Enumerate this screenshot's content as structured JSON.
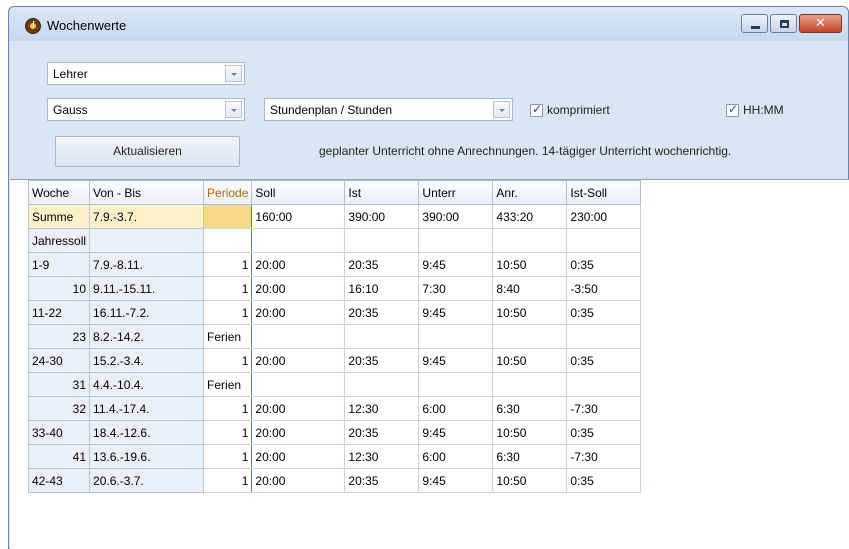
{
  "window": {
    "title": "Wochenwerte"
  },
  "filters": {
    "type_select": "Lehrer",
    "person_select": "Gauss",
    "view_select": "Stundenplan / Stunden",
    "komprimiert_label": "komprimiert",
    "komprimiert_checked": true,
    "hhmm_label": "HH:MM",
    "hhmm_checked": true,
    "refresh_label": "Aktualisieren",
    "hint": "geplanter Unterricht ohne Anrechnungen. 14-tägiger Unterricht wochenrichtig."
  },
  "table": {
    "columns": [
      "Woche",
      "Von - Bis",
      "Periode",
      "Soll",
      "Ist",
      "Unterr",
      "Anr.",
      "Ist-Soll"
    ],
    "rows": [
      [
        "Summe",
        "7.9.-3.7.",
        "",
        "160:00",
        "390:00",
        "390:00",
        "433:20",
        "230:00"
      ],
      [
        "Jahressoll",
        "",
        "",
        "",
        "",
        "",
        "",
        ""
      ],
      [
        "1-9",
        "7.9.-8.11.",
        "1",
        "20:00",
        "20:35",
        "9:45",
        "10:50",
        "0:35"
      ],
      [
        "10",
        "9.11.-15.11.",
        "1",
        "20:00",
        "16:10",
        "7:30",
        "8:40",
        "-3:50"
      ],
      [
        "11-22",
        "16.11.-7.2.",
        "1",
        "20:00",
        "20:35",
        "9:45",
        "10:50",
        "0:35"
      ],
      [
        "23",
        "8.2.-14.2.",
        "Ferien",
        "",
        "",
        "",
        "",
        ""
      ],
      [
        "24-30",
        "15.2.-3.4.",
        "1",
        "20:00",
        "20:35",
        "9:45",
        "10:50",
        "0:35"
      ],
      [
        "31",
        "4.4.-10.4.",
        "Ferien",
        "",
        "",
        "",
        "",
        ""
      ],
      [
        "32",
        "11.4.-17.4.",
        "1",
        "20:00",
        "12:30",
        "6:00",
        "6:30",
        "-7:30"
      ],
      [
        "33-40",
        "18.4.-12.6.",
        "1",
        "20:00",
        "20:35",
        "9:45",
        "10:50",
        "0:35"
      ],
      [
        "41",
        "13.6.-19.6.",
        "1",
        "20:00",
        "12:30",
        "6:00",
        "6:30",
        "-7:30"
      ],
      [
        "42-43",
        "20.6.-3.7.",
        "1",
        "20:00",
        "20:35",
        "9:45",
        "10:50",
        "0:35"
      ]
    ]
  }
}
